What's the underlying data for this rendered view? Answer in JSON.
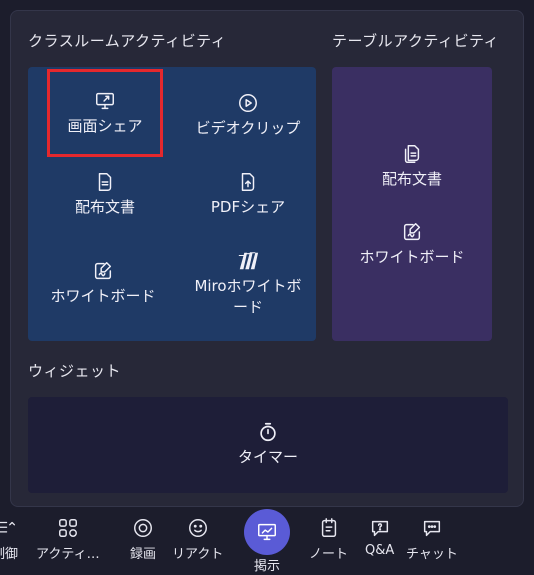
{
  "popup": {
    "class_title": "クラスルームアクティビティ",
    "table_title": "テーブルアクティビティ",
    "widget_title": "ウィジェット",
    "class_tiles": [
      {
        "label": "画面シェア",
        "icon": "screen-share-icon"
      },
      {
        "label": "ビデオクリップ",
        "icon": "play-circle-icon"
      },
      {
        "label": "配布文書",
        "icon": "document-icon"
      },
      {
        "label": "PDFシェア",
        "icon": "pdf-upload-icon"
      },
      {
        "label": "ホワイトボード",
        "icon": "whiteboard-icon"
      },
      {
        "label": "Miroホワイトボード",
        "icon": "miro-logo-icon"
      }
    ],
    "table_tiles": [
      {
        "label": "配布文書",
        "icon": "documents-icon"
      },
      {
        "label": "ホワイトボード",
        "icon": "whiteboard-icon"
      }
    ],
    "widget": {
      "label": "タイマー",
      "icon": "stopwatch-icon"
    }
  },
  "toolbar": {
    "items": [
      {
        "label": "制御",
        "icon": "control-icon"
      },
      {
        "label": "アクティ…",
        "icon": "activity-icon"
      },
      {
        "label": "録画",
        "icon": "record-icon"
      },
      {
        "label": "リアクト",
        "icon": "smiley-icon"
      },
      {
        "label": "掲示",
        "icon": "present-icon"
      },
      {
        "label": "ノート",
        "icon": "notes-icon"
      },
      {
        "label": "Q&A",
        "icon": "qa-icon"
      },
      {
        "label": "チャット",
        "icon": "chat-icon"
      }
    ]
  },
  "colors": {
    "class_panel": "#1f3a66",
    "table_panel": "#3a2f62",
    "widget_panel": "#1e1e38",
    "highlight": "#e5282d",
    "present_button": "#5a5bd6"
  }
}
